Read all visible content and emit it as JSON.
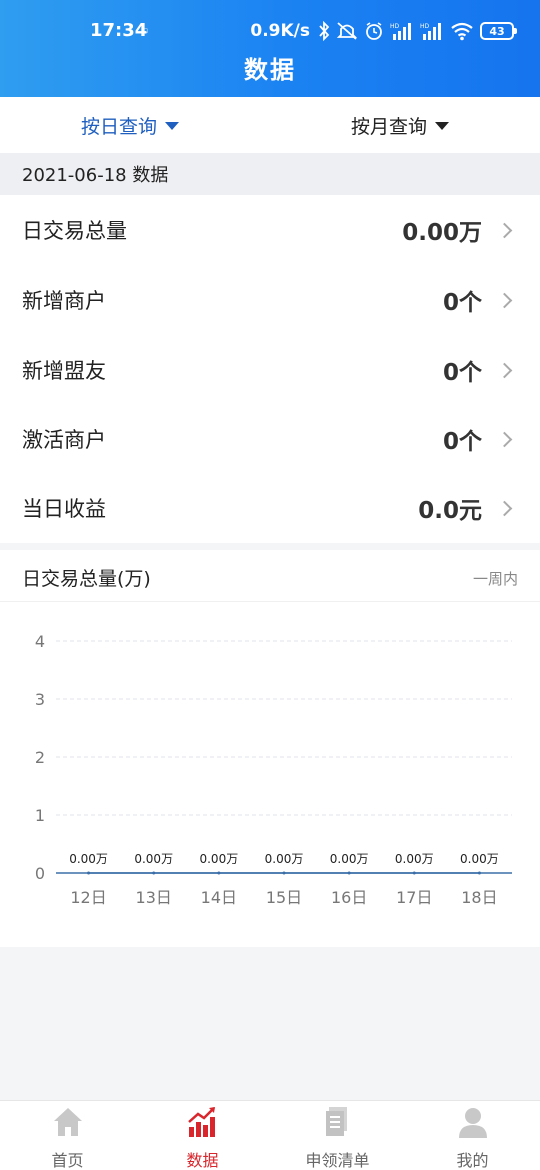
{
  "status": {
    "time": "17:34",
    "sim_indicator": "▫",
    "net_speed": "0.9K/s",
    "battery": "43",
    "icons": [
      "bluetooth-icon",
      "mute-icon",
      "alarm-icon",
      "signal-hd-icon",
      "signal-hd-icon",
      "wifi-icon",
      "battery-icon"
    ]
  },
  "page": {
    "title": "数据"
  },
  "query": {
    "tabs": [
      {
        "label": "按日查询",
        "active": true
      },
      {
        "label": "按月查询",
        "active": false
      }
    ]
  },
  "date_header": "2021-06-18 数据",
  "stats": [
    {
      "label": "日交易总量",
      "value": "0.00万"
    },
    {
      "label": "新增商户",
      "value": "0个"
    },
    {
      "label": "新增盟友",
      "value": "0个"
    },
    {
      "label": "激活商户",
      "value": "0个"
    },
    {
      "label": "当日收益",
      "value": "0.0元"
    }
  ],
  "chart_section": {
    "title": "日交易总量(万)",
    "range_label": "一周内"
  },
  "chart_data": {
    "type": "line",
    "categories": [
      "12日",
      "13日",
      "14日",
      "15日",
      "16日",
      "17日",
      "18日"
    ],
    "values": [
      0,
      0,
      0,
      0,
      0,
      0,
      0
    ],
    "data_labels": [
      "0.00万",
      "0.00万",
      "0.00万",
      "0.00万",
      "0.00万",
      "0.00万",
      "0.00万"
    ],
    "y_ticks": [
      0,
      1,
      2,
      3,
      4
    ],
    "ylim": [
      0,
      4
    ],
    "grid": true,
    "line_color": "#3b6ea8"
  },
  "tabbar": {
    "items": [
      {
        "label": "首页",
        "icon": "home-icon",
        "active": false
      },
      {
        "label": "数据",
        "icon": "chart-icon",
        "active": true
      },
      {
        "label": "申领清单",
        "icon": "document-icon",
        "active": false
      },
      {
        "label": "我的",
        "icon": "user-icon",
        "active": false
      }
    ]
  },
  "colors": {
    "header_start": "#2f9df0",
    "header_end": "#1574ee",
    "active_query": "#1f5fbf",
    "active_tab": "#d9262c"
  }
}
